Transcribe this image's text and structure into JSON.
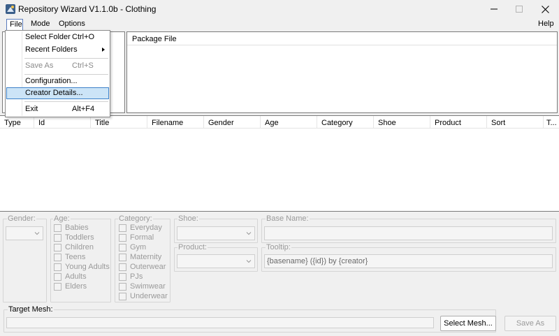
{
  "window": {
    "title": "Repository Wizard V1.1.0b - Clothing",
    "icon": "app-icon"
  },
  "menubar": {
    "items": [
      {
        "label": "File"
      },
      {
        "label": "Mode"
      },
      {
        "label": "Options"
      }
    ],
    "help": "Help"
  },
  "file_menu": {
    "items": [
      {
        "label": "Select Folder",
        "shortcut": "Ctrl+O",
        "enabled": true
      },
      {
        "label": "Recent Folders",
        "shortcut": "",
        "submenu": true,
        "enabled": true
      },
      {
        "label": "Save As",
        "shortcut": "Ctrl+S",
        "enabled": false
      },
      {
        "label": "Configuration...",
        "shortcut": "",
        "enabled": true
      },
      {
        "label": "Creator Details...",
        "shortcut": "",
        "enabled": true,
        "highlighted": true
      },
      {
        "label": "Exit",
        "shortcut": "Alt+F4",
        "enabled": true
      }
    ]
  },
  "package_panel": {
    "header": "Package File"
  },
  "list": {
    "columns": [
      "Type",
      "Id",
      "Title",
      "Filename",
      "Gender",
      "Age",
      "Category",
      "Shoe",
      "Product",
      "Sort",
      "T..."
    ]
  },
  "details": {
    "gender": {
      "label": "Gender:",
      "value": ""
    },
    "age": {
      "label": "Age:",
      "options": [
        "Babies",
        "Toddlers",
        "Children",
        "Teens",
        "Young Adults",
        "Adults",
        "Elders"
      ]
    },
    "category": {
      "label": "Category:",
      "options": [
        "Everyday",
        "Formal",
        "Gym",
        "Maternity",
        "Outerwear",
        "PJs",
        "Swimwear",
        "Underwear"
      ]
    },
    "shoe": {
      "label": "Shoe:",
      "value": ""
    },
    "product": {
      "label": "Product:",
      "value": ""
    },
    "base_name": {
      "label": "Base Name:",
      "value": ""
    },
    "tooltip": {
      "label": "Tooltip:",
      "value": "{basename} ({id}) by {creator}"
    },
    "target_mesh": {
      "label": "Target Mesh:",
      "value": ""
    },
    "select_mesh_button": "Select Mesh...",
    "save_as_button": "Save As"
  },
  "colors": {
    "window_bg": "#f0f0f0",
    "menu_highlight_bg": "#cce4f7",
    "menu_highlight_border": "#3c80c8",
    "disabled_text": "#9a9a9a"
  }
}
